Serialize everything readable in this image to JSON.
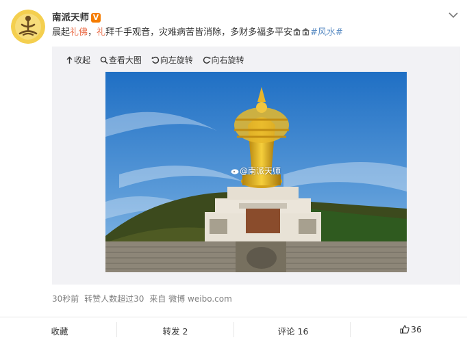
{
  "post": {
    "author": "南派天师",
    "verified_badge": "V",
    "text_prefix": "晨起",
    "text_link1": "礼佛",
    "text_comma": "，",
    "text_link2": "礼",
    "text_main": "拜千手观音，灾难病苦皆消除，多财多福多平安",
    "hashtag": "#风水#"
  },
  "media_toolbar": {
    "collapse": "收起",
    "view_large": "查看大图",
    "rotate_left": "向左旋转",
    "rotate_right": "向右旋转"
  },
  "image": {
    "watermark": "@南派天师"
  },
  "meta": {
    "time": "30秒前",
    "reposts_note": "转赞人数超过30",
    "source_prefix": "来自",
    "source": "微博 weibo.com"
  },
  "actions": {
    "favorite": "收藏",
    "repost": "转发 2",
    "comment": "评论 16",
    "like": "36"
  },
  "colors": {
    "highlight_red": "#eb7350",
    "hashtag_blue": "#5d8ec4",
    "verified_orange": "#f57c00"
  },
  "icons": [
    "avatar-meditation",
    "chevron-down-icon",
    "collapse-icon",
    "search-icon",
    "rotate-left-icon",
    "rotate-right-icon",
    "thumbs-up-icon",
    "weibo-logo-icon"
  ]
}
